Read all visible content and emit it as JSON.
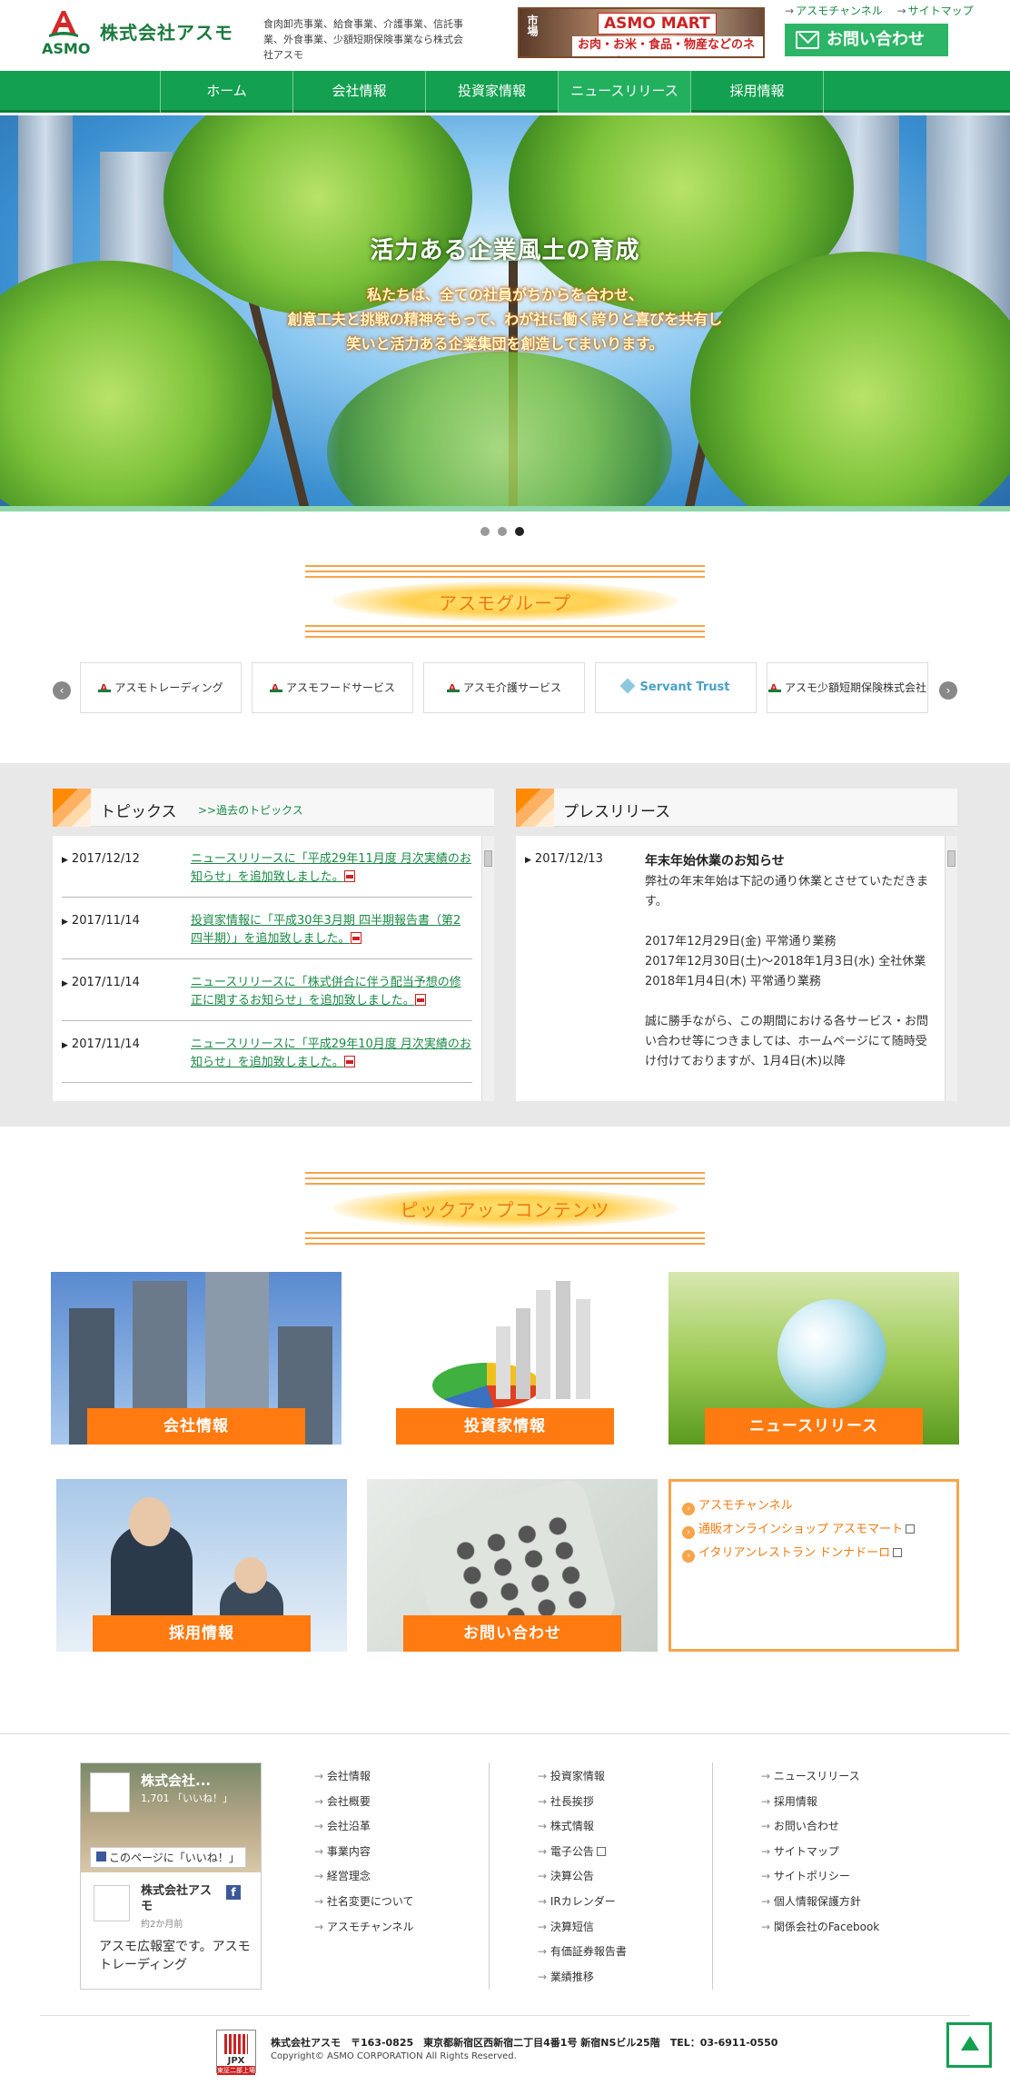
{
  "header": {
    "logo_text": "ASMO",
    "company_name": "株式会社アスモ",
    "description": "食肉卸売事業、給食事業、介護事業、信託事業、外食事業、少額短期保険事業なら株式会社アスモ",
    "mart_banner": {
      "brand": "ASMO MART",
      "tagline": "お肉・お米・食品・物産などのネット販売",
      "side": "市場"
    },
    "top_links": [
      "アスモチャンネル",
      "サイトマップ"
    ],
    "contact_label": "お問い合わせ"
  },
  "nav": {
    "items": [
      "ホーム",
      "会社情報",
      "投資家情報",
      "ニュースリリース",
      "採用情報"
    ],
    "current_index": 3
  },
  "hero": {
    "title": "活力ある企業風土の育成",
    "lines": [
      "私たちは、全ての社員がちからを合わせ、",
      "創意工夫と挑戦の精神をもって、わが社に働く誇りと喜びを共有し",
      "笑いと活力ある企業集団を創造してまいります。"
    ],
    "slide_count": 3,
    "active_slide": 3
  },
  "group": {
    "title": "アスモグループ",
    "prev": "‹",
    "next": "›",
    "items": [
      "アスモトレーディング",
      "アスモフードサービス",
      "アスモ介護サービス",
      "Servant Trust",
      "アスモ少額短期保険株式会社"
    ]
  },
  "topics": {
    "title": "トピックス",
    "past_link": ">>過去のトピックス",
    "items": [
      {
        "date": "2017/12/12",
        "text": "ニュースリリースに「平成29年11月度 月次実績のお知らせ」を追加致しました。"
      },
      {
        "date": "2017/11/14",
        "text": "投資家情報に「平成30年3月期 四半期報告書（第2四半期）」を追加致しました。"
      },
      {
        "date": "2017/11/14",
        "text": "ニュースリリースに「株式併合に伴う配当予想の修正に関するお知らせ」を追加致しました。"
      },
      {
        "date": "2017/11/14",
        "text": "ニュースリリースに「平成29年10月度 月次実績のお知らせ」を追加致しました。"
      }
    ]
  },
  "press": {
    "title": "プレスリリース",
    "date": "2017/12/13",
    "heading": "年末年始休業のお知らせ",
    "body": "弊社の年末年始は下記の通り休業とさせていただきます。\n\n2017年12月29日(金) 平常通り業務\n2017年12月30日(土)～2018年1月3日(水) 全社休業\n2018年1月4日(木) 平常通り業務\n\n誠に勝手ながら、この期間における各サービス・お問い合わせ等につきましては、ホームページにて随時受け付けておりますが、1月4日(木)以降"
  },
  "pickup": {
    "title": "ピックアップコンテンツ",
    "cards": [
      "会社情報",
      "投資家情報",
      "ニュースリリース",
      "採用情報",
      "お問い合わせ"
    ],
    "links": [
      "アスモチャンネル",
      "通販オンラインショップ アスモマート",
      "イタリアンレストラン ドンナドーロ"
    ]
  },
  "facebook": {
    "page_name": "株式会社...",
    "likes": "1,701 「いいね！」",
    "like_button": "このページに「いいね！」",
    "post_name": "株式会社アスモ",
    "post_ago": "約2か月前",
    "post_text": "アスモ広報室です。アスモトレーディング"
  },
  "footer": {
    "col1": [
      "会社情報",
      "会社概要",
      "会社沿革",
      "事業内容",
      "経営理念",
      "社名変更について",
      "アスモチャンネル"
    ],
    "col2": [
      "投資家情報",
      "社長挨拶",
      "株式情報",
      "電子公告",
      "決算公告",
      "IRカレンダー",
      "決算短信",
      "有価証券報告書",
      "業績推移"
    ],
    "col3": [
      "ニュースリリース",
      "採用情報",
      "お問い合わせ",
      "サイトマップ",
      "サイトポリシー",
      "個人情報保護方針",
      "関係会社のFacebook"
    ],
    "jpx_label": "JPX",
    "jpx_sub": "東証二部上場",
    "address": "株式会社アスモ　〒163-0825　東京都新宿区西新宿二丁目4番1号 新宿NSビル25階　TEL：03-6911-0550",
    "copyright": "Copyright© ASMO CORPORATION All Rights Reserved."
  },
  "colors": {
    "brand_green": "#13a050",
    "accent_orange": "#ff7a10"
  }
}
